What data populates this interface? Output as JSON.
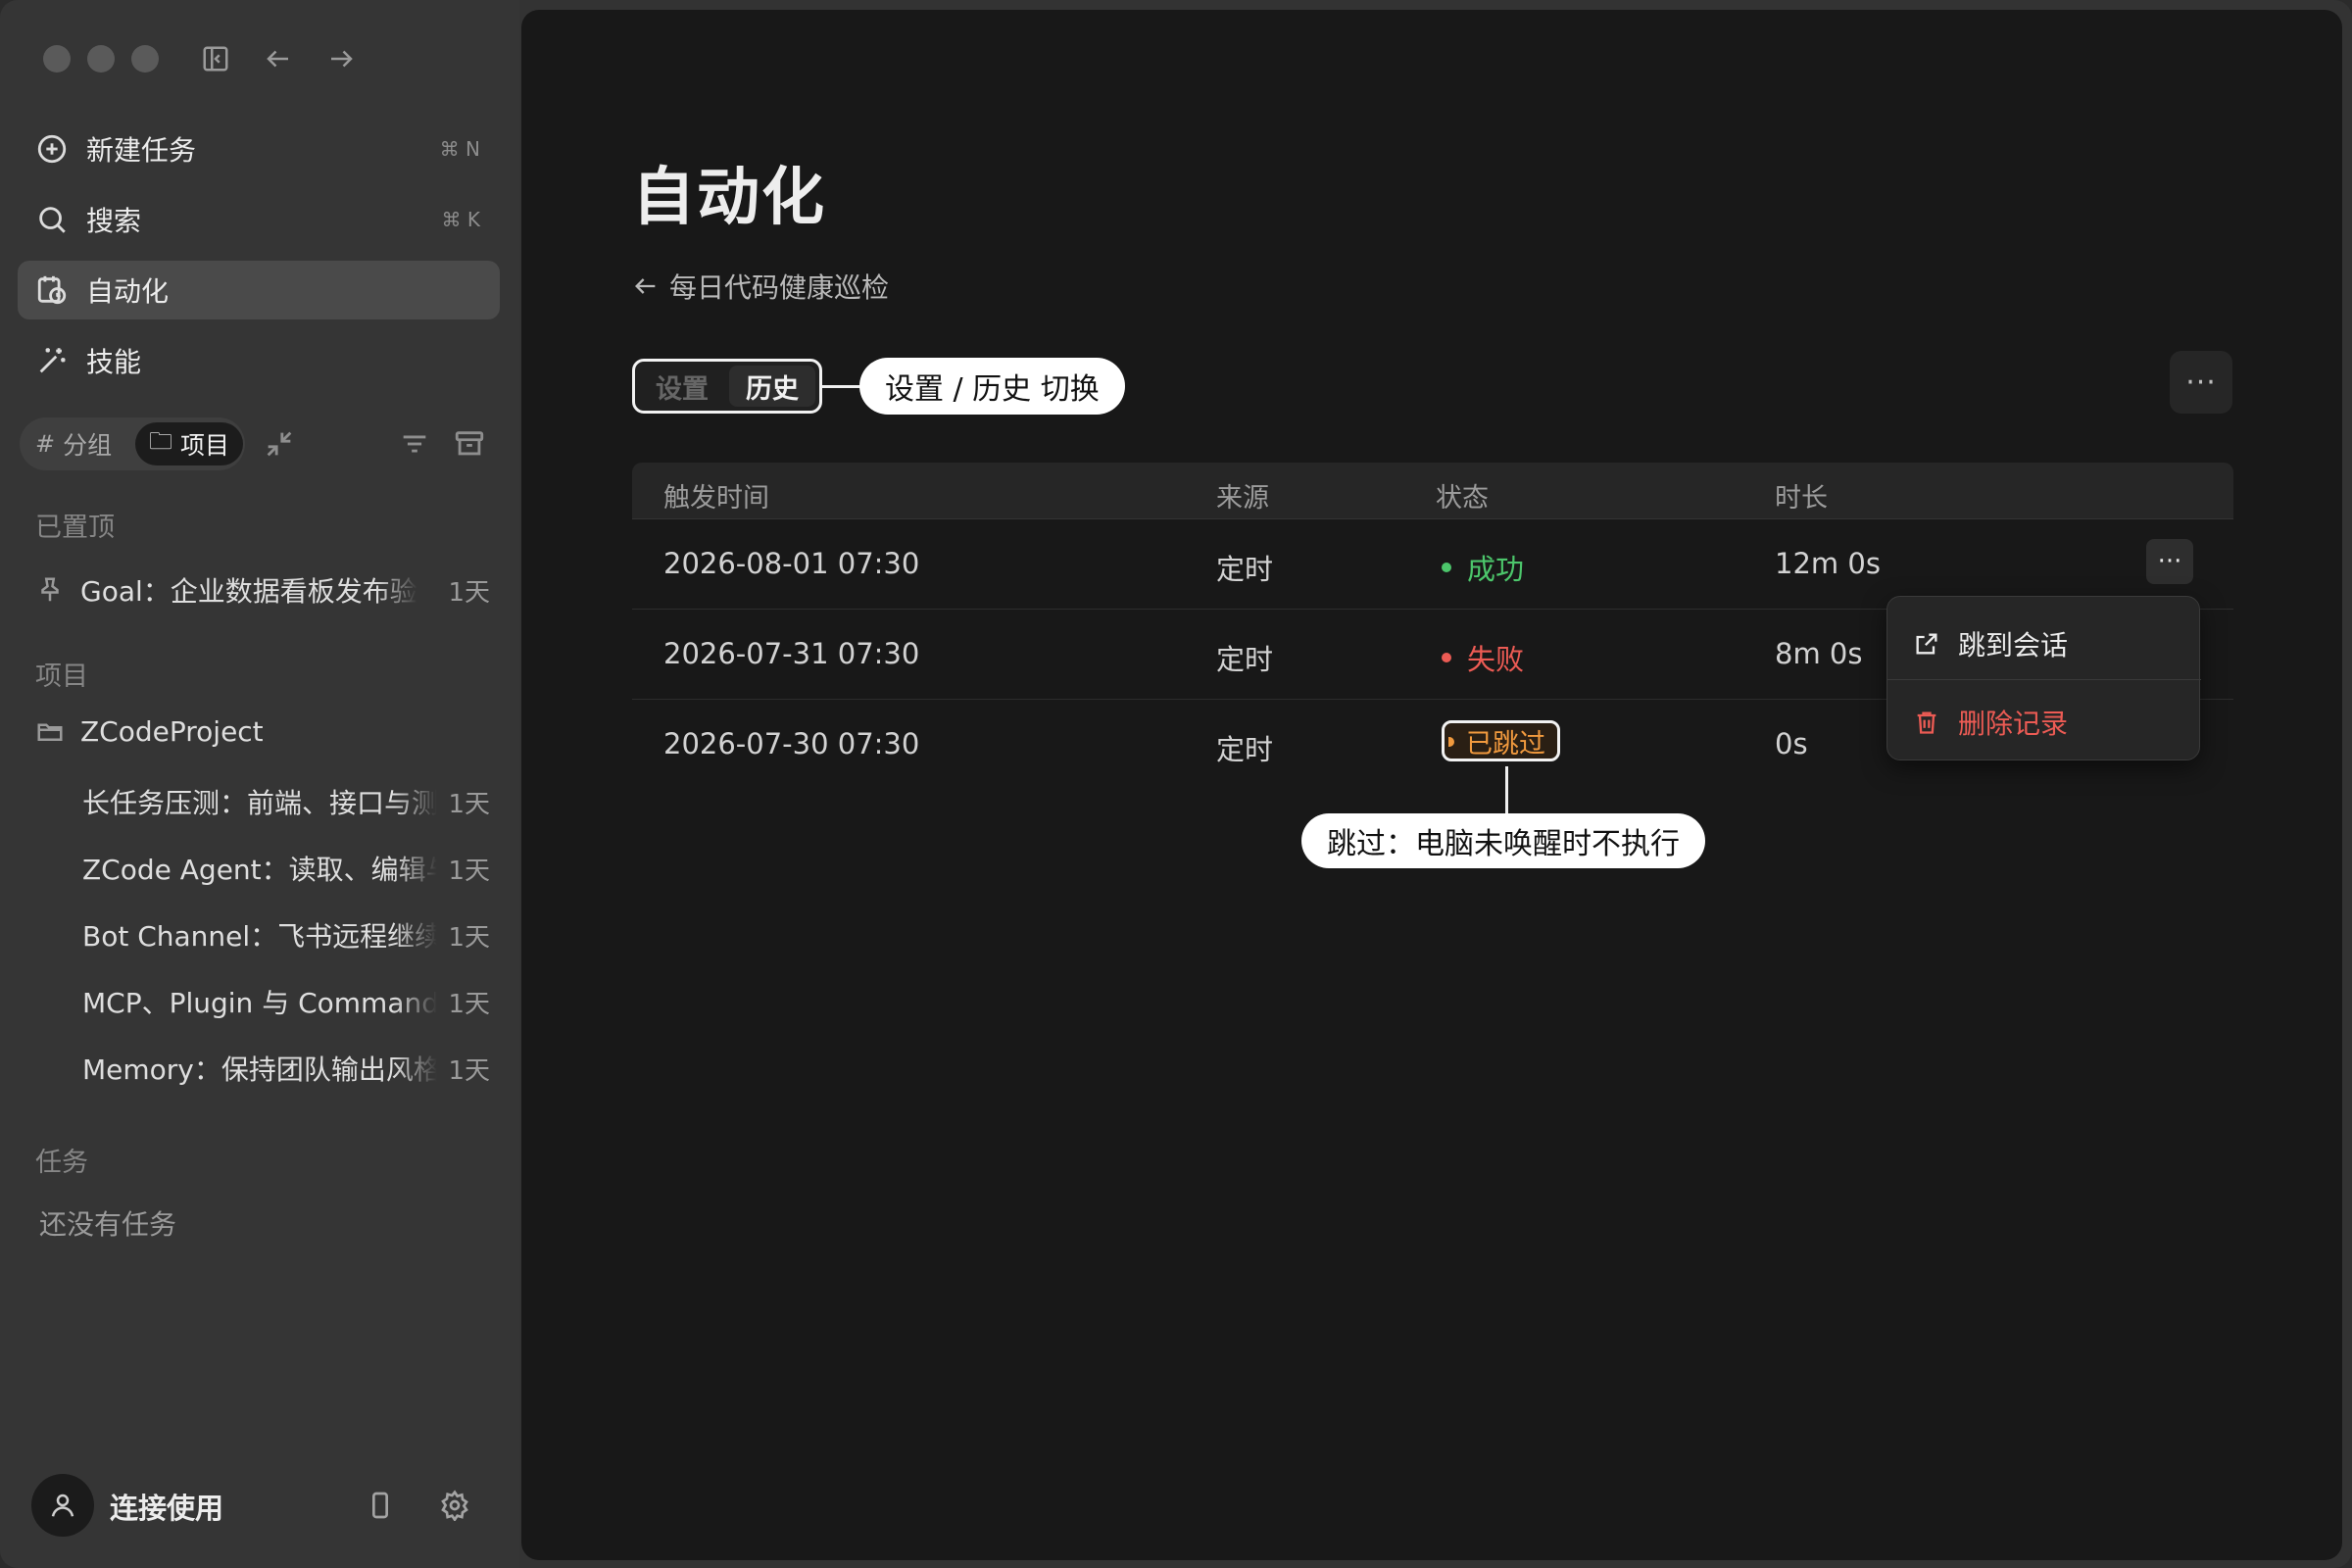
{
  "sidebar": {
    "nav": {
      "new_task": "新建任务",
      "new_task_shortcut": "⌘ N",
      "search": "搜索",
      "search_shortcut": "⌘ K",
      "automation": "自动化",
      "skills": "技能"
    },
    "group_toggle": {
      "group": "分组",
      "project": "项目"
    },
    "pinned_header": "已置顶",
    "pinned": [
      {
        "label": "Goal：企业数据看板发布验收",
        "age": "1天"
      }
    ],
    "projects_header": "项目",
    "project_name": "ZCodeProject",
    "project_items": [
      {
        "label": "长任务压测：前端、接口与测试",
        "age": "1天"
      },
      {
        "label": "ZCode Agent：读取、编辑与",
        "age": "1天"
      },
      {
        "label": "Bot Channel：飞书远程继续任务",
        "age": "1天"
      },
      {
        "label": "MCP、Plugin 与 Command：",
        "age": "1天"
      },
      {
        "label": "Memory：保持团队输出风格",
        "age": "1天"
      }
    ],
    "tasks_header": "任务",
    "tasks_empty": "还没有任务",
    "user_label": "连接使用"
  },
  "main": {
    "title": "自动化",
    "back_label": "每日代码健康巡检",
    "tabs": {
      "settings": "设置",
      "history": "历史"
    },
    "more_label": "···",
    "table": {
      "headers": [
        "触发时间",
        "来源",
        "状态",
        "时长"
      ],
      "rows": [
        {
          "time": "2026-08-01 07:30",
          "source": "定时",
          "status": "成功",
          "duration": "12m 0s",
          "status_color": "#4cc66b"
        },
        {
          "time": "2026-07-31 07:30",
          "source": "定时",
          "status": "失败",
          "duration": "8m 0s",
          "status_color": "#ec5b54"
        },
        {
          "time": "2026-07-30 07:30",
          "source": "定时",
          "status": "已跳过",
          "duration": "0s",
          "status_color": "#f19a3e"
        }
      ]
    },
    "row_menu": {
      "jump": "跳到会话",
      "delete": "删除记录"
    }
  },
  "annotations": {
    "tabs_callout": "设置 / 历史 切换",
    "skip_callout": "跳过：电脑未唤醒时不执行"
  },
  "colors": {
    "success": "#4cc66b",
    "fail": "#ec5b54",
    "skipped": "#f19a3e",
    "danger": "#ec5b54"
  }
}
